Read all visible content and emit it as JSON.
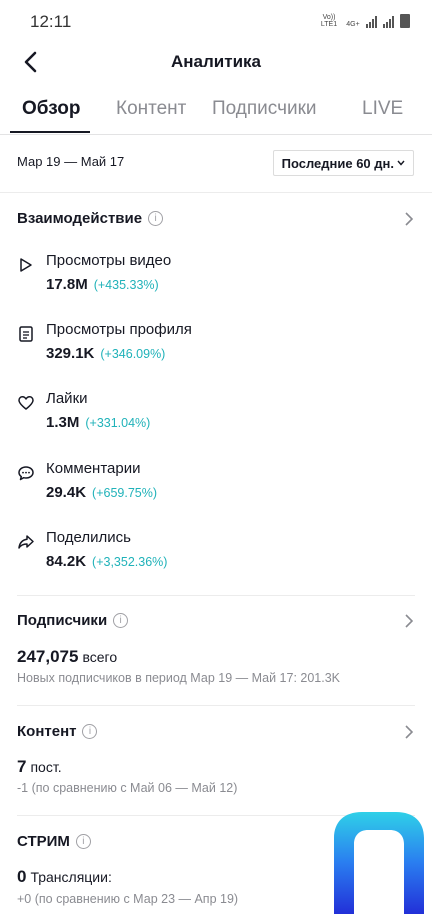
{
  "status": {
    "time": "12:11",
    "network": "Vo)) LTE1",
    "signal": "4G+"
  },
  "header": {
    "title": "Аналитика"
  },
  "tabs": [
    {
      "label": "Обзор",
      "active": true
    },
    {
      "label": "Контент",
      "active": false
    },
    {
      "label": "Подписчики",
      "active": false
    },
    {
      "label": "LIVE",
      "active": false
    }
  ],
  "date_range": {
    "label": "Мар 19 — Май 17",
    "period": "Последние 60 дн."
  },
  "engagement": {
    "title": "Взаимодействие",
    "metrics": [
      {
        "icon": "play-icon",
        "label": "Просмотры видео",
        "value": "17.8M",
        "delta": "(+435.33%)"
      },
      {
        "icon": "profile-icon",
        "label": "Просмотры профиля",
        "value": "329.1K",
        "delta": "(+346.09%)"
      },
      {
        "icon": "heart-icon",
        "label": "Лайки",
        "value": "1.3M",
        "delta": "(+331.04%)"
      },
      {
        "icon": "comment-icon",
        "label": "Комментарии",
        "value": "29.4K",
        "delta": "(+659.75%)"
      },
      {
        "icon": "share-icon",
        "label": "Поделились",
        "value": "84.2K",
        "delta": "(+3,352.36%)"
      }
    ]
  },
  "followers": {
    "title": "Подписчики",
    "count": "247,075",
    "unit": "всего",
    "note": "Новых подписчиков в период Мар 19 — Май 17: 201.3K"
  },
  "content": {
    "title": "Контент",
    "count": "7",
    "unit": "пост.",
    "note": "-1 (по сравнению с Май 06 — Май 12)"
  },
  "live": {
    "title": "СТРИМ",
    "count": "0",
    "unit": "Трансляции:",
    "note": "+0 (по сравнению с Мар 23 — Апр 19)"
  },
  "colors": {
    "accent": "#20b2b9",
    "text": "#161823",
    "muted": "#8a8b91"
  }
}
